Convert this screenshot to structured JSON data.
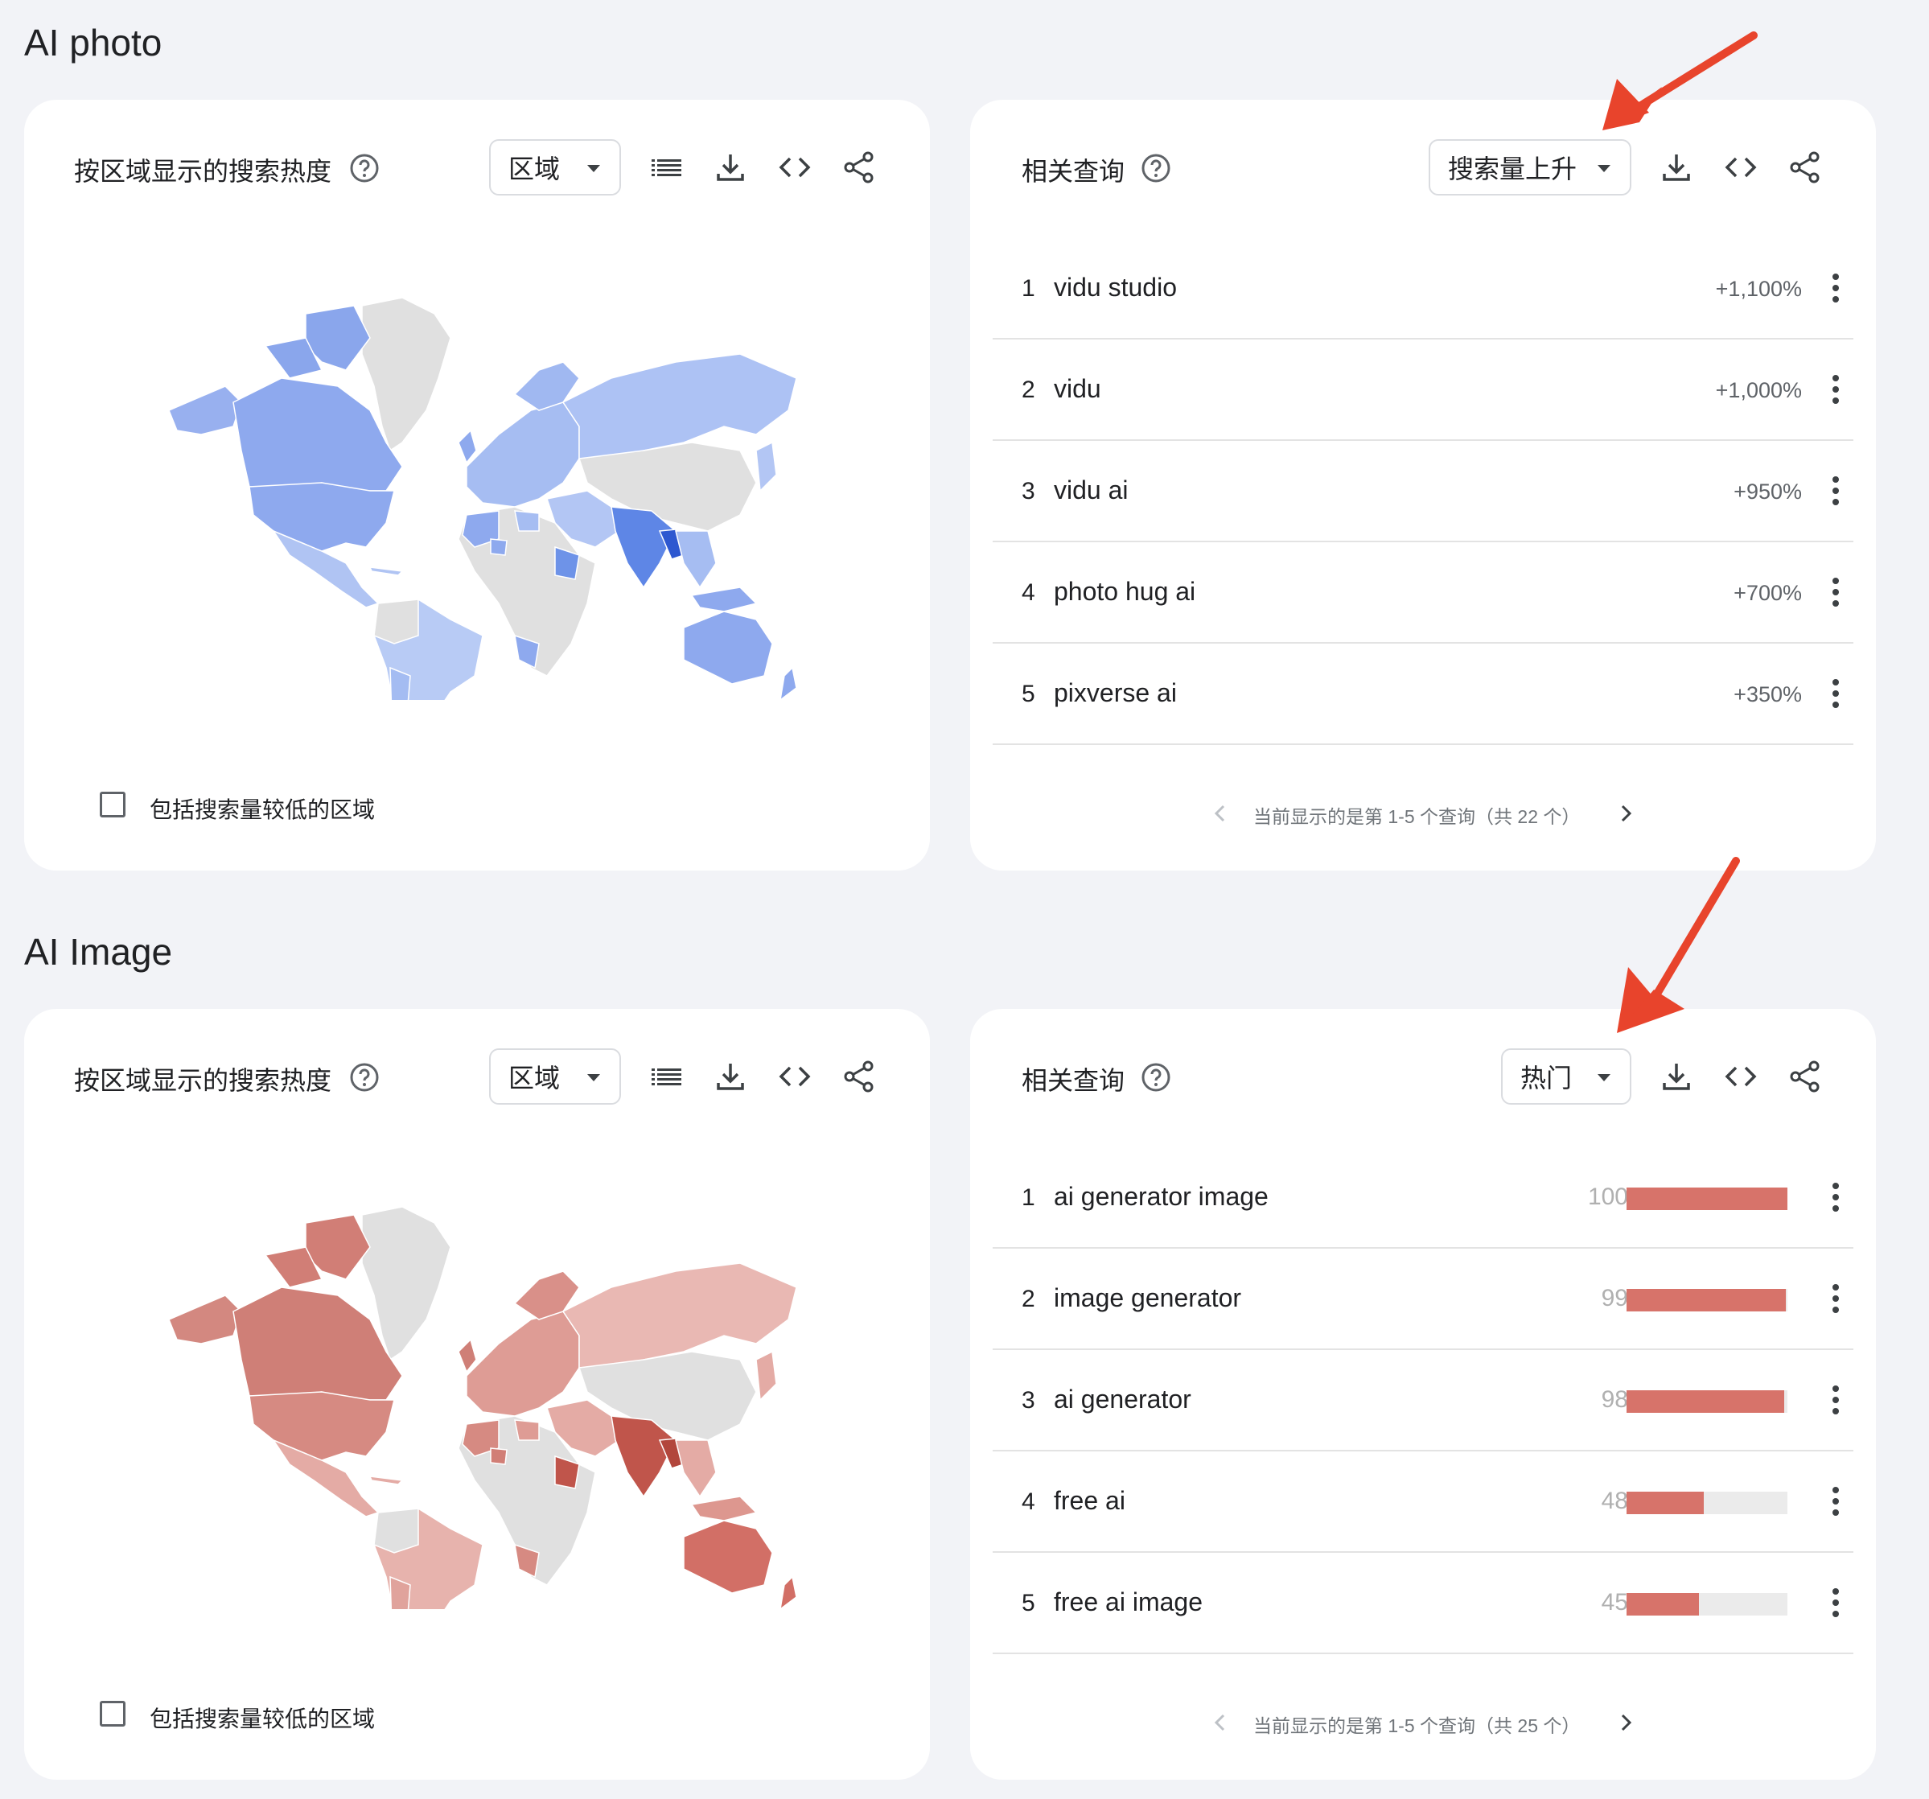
{
  "sections": [
    {
      "title": "AI photo",
      "map_card": {
        "title": "按区域显示的搜索热度",
        "dropdown": "区域",
        "checkbox_label": "包括搜索量较低的区域",
        "map_color_scheme": "blue",
        "accent": "#5e86e6"
      },
      "queries_card": {
        "title": "相关查询",
        "dropdown": "搜索量上升",
        "type": "rising",
        "rows": [
          {
            "rank": "1",
            "query": "vidu studio",
            "value": "+1,100%"
          },
          {
            "rank": "2",
            "query": "vidu",
            "value": "+1,000%"
          },
          {
            "rank": "3",
            "query": "vidu ai",
            "value": "+950%"
          },
          {
            "rank": "4",
            "query": "photo hug ai",
            "value": "+700%"
          },
          {
            "rank": "5",
            "query": "pixverse ai",
            "value": "+350%"
          }
        ],
        "pager": "当前显示的是第 1-5 个查询（共 22 个）"
      }
    },
    {
      "title": "AI Image",
      "map_card": {
        "title": "按区域显示的搜索热度",
        "dropdown": "区域",
        "checkbox_label": "包括搜索量较低的区域",
        "map_color_scheme": "red",
        "accent": "#c9584e"
      },
      "queries_card": {
        "title": "相关查询",
        "dropdown": "热门",
        "type": "top",
        "rows": [
          {
            "rank": "1",
            "query": "ai generator image",
            "score": "100",
            "level": 100
          },
          {
            "rank": "2",
            "query": "image generator",
            "score": "99",
            "level": 99
          },
          {
            "rank": "3",
            "query": "ai generator",
            "score": "98",
            "level": 98
          },
          {
            "rank": "4",
            "query": "free ai",
            "score": "48",
            "level": 48
          },
          {
            "rank": "5",
            "query": "free ai image",
            "score": "45",
            "level": 45
          }
        ],
        "pager": "当前显示的是第 1-5 个查询（共 25 个）"
      }
    }
  ],
  "colors": {
    "background": "#f2f3f7",
    "card": "#ffffff",
    "bar": "#d7736a",
    "annotation_arrow": "#e8442c"
  },
  "icons": [
    "help-icon",
    "chevron-down-icon",
    "list-icon",
    "download-icon",
    "embed-icon",
    "share-icon",
    "more-vert-icon",
    "chevron-left-icon",
    "chevron-right-icon"
  ]
}
